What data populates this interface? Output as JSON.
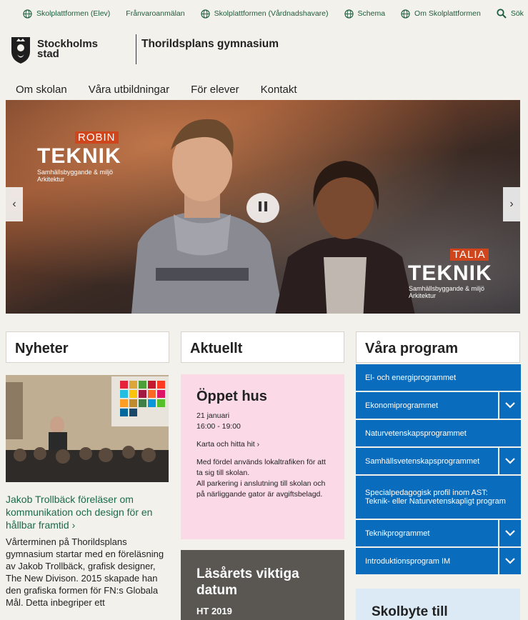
{
  "top_links": [
    "Skolplattformen (Elev)",
    "Frånvaroanmälan",
    "Skolplattformen (Vårdnadshavare)",
    "Schema",
    "Om Skolplattformen"
  ],
  "search_label": "Sök",
  "logo": {
    "line1": "Stockholms",
    "line2": "stad"
  },
  "school_name": "Thorildsplans gymnasium",
  "main_nav": [
    "Om skolan",
    "Våra utbildningar",
    "För elever",
    "Kontakt"
  ],
  "hero": {
    "left": {
      "name": "ROBIN",
      "program": "TEKNIK",
      "sub1": "Samhällsbyggande & miljö",
      "sub2": "Arkitektur"
    },
    "right": {
      "name": "TALIA",
      "program": "TEKNIK",
      "sub1": "Samhällsbyggande & miljö",
      "sub2": "Arkitektur"
    }
  },
  "news": {
    "heading": "Nyheter",
    "title": "Jakob Trollbäck föreläser om kommunikation och design för en hållbar framtid ›",
    "body": "Vårterminen på Thorildsplans gymnasium startar med en föreläsning av Jakob Trollbäck, grafisk designer, The New Divison. 2015 skapade han den grafiska formen för FN:s Globala Mål. Detta inbegriper ett"
  },
  "aktuellt": {
    "heading": "Aktuellt",
    "event_title": "Öppet hus",
    "date": "21 januari",
    "time": "16:00 - 19:00",
    "map_link": "Karta och hitta hit ›",
    "info1": "Med fördel används lokaltrafiken för att ta sig till skolan.",
    "info2": "All parkering i anslutning till skolan och på närliggande gator är avgiftsbelagd.",
    "dates_title": "Läsårets viktiga datum",
    "dates_term": "HT 2019"
  },
  "program": {
    "heading": "Våra program",
    "items": [
      "El- och energiprogrammet",
      "Ekonomiprogrammet",
      "Naturvetenskapsprogrammet",
      "Samhällsvetenskapsprogrammet",
      "Specialpedagogisk profil inom AST: Teknik- eller Naturvetenskapligt program",
      "Teknikprogrammet",
      "Introduktionsprogram IM"
    ],
    "skolbyte_title": "Skolbyte till"
  },
  "colors": {
    "accent_green": "#1b5b3a",
    "program_blue": "#0a6cbc",
    "event_pink": "#fbd9e6",
    "hero_orange": "#d0451b"
  }
}
